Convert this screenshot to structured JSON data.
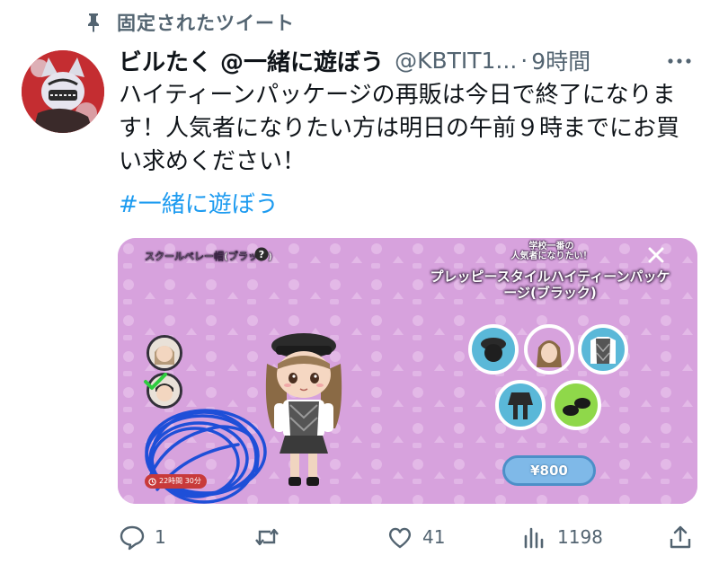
{
  "pinned": {
    "label": "固定されたツイート"
  },
  "tweet": {
    "display_name": "ビルたく @一緒に遊ぼう",
    "handle": "@KBTIT1...",
    "dot": "·",
    "time": "9時間",
    "text": "ハイティーンパッケージの再販は今日で終了になります！人気者になりたい方は明日の午前９時までにお買い求めください！",
    "hashtag": "#一緒に遊ぼう"
  },
  "media": {
    "item_name": "スクールベレー帽(ブラック)",
    "promo_subtitle": "学校一番の\n人気者になりたい！",
    "promo_title": "プレッピースタイルハイティーンパッケージ(ブラック)",
    "price": "¥800",
    "timer": "22時間 30分"
  },
  "actions": {
    "replies": "1",
    "likes": "41",
    "views": "1198"
  },
  "colors": {
    "accent": "#1d9bf0",
    "secondary_text": "#536471",
    "media_background": "#d7a2dd"
  }
}
